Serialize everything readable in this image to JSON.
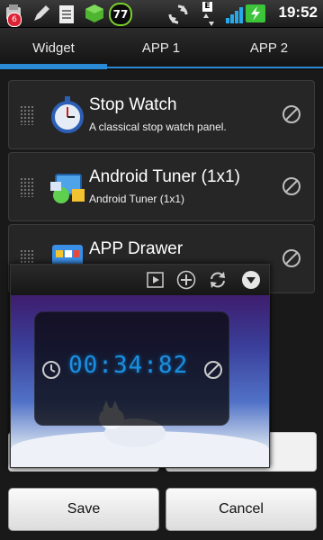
{
  "status_bar": {
    "notification_count": "6",
    "battery_level_text": "77",
    "network_type": "E",
    "time": "19:52"
  },
  "tabs": [
    {
      "label": "Widget",
      "active": true
    },
    {
      "label": "APP 1",
      "active": false
    },
    {
      "label": "APP 2",
      "active": false
    }
  ],
  "widgets": [
    {
      "title": "Stop Watch",
      "description": "A classical stop watch panel.",
      "icon": "stopwatch-icon"
    },
    {
      "title": "Android Tuner (1x1)",
      "description": "Android Tuner (1x1)",
      "icon": "android-tuner-icon"
    },
    {
      "title": "APP Drawer",
      "description": "",
      "icon": "app-drawer-icon"
    }
  ],
  "preview": {
    "timer_display": "00:34:82"
  },
  "buttons": {
    "save": "Save",
    "cancel": "Cancel"
  },
  "colors": {
    "accent": "#2a8ad6",
    "timer_digits": "#1c8fe1"
  }
}
